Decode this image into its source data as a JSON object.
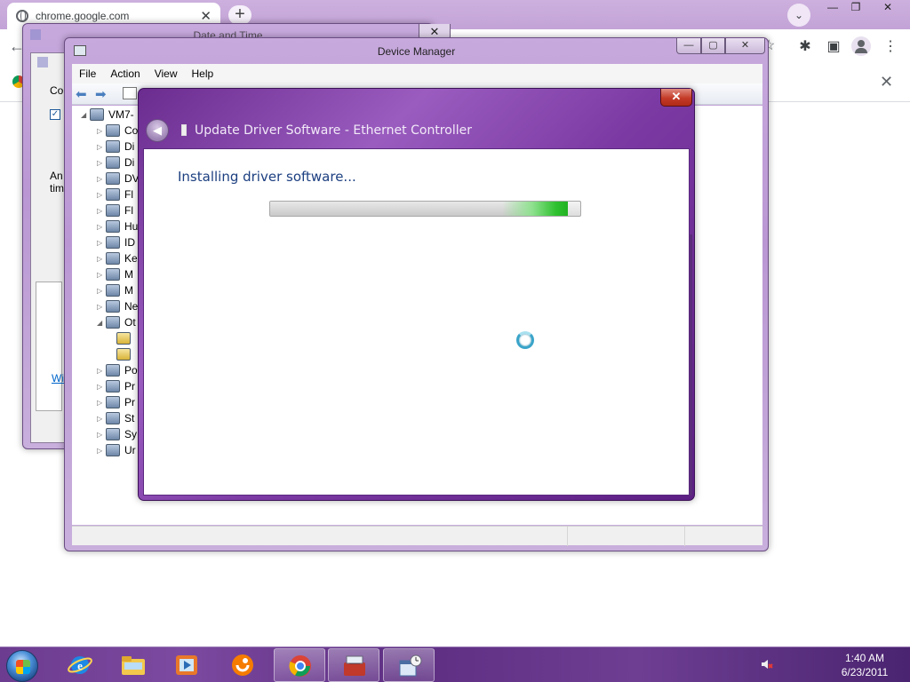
{
  "browser": {
    "tab_title": "chrome.google.com",
    "tab_close": "✕",
    "new_tab": "+",
    "tab_search": "⌄",
    "window_minimize": "—",
    "window_restore": "❐",
    "window_close": "✕",
    "back": "←",
    "star": "☆",
    "infobar_close": "✕"
  },
  "date_time": {
    "title": "Date and Time",
    "close": "✕",
    "label_co": "Co",
    "label_an": "An",
    "label_tim": "tim",
    "link_wi": "Wi",
    "check": "✓"
  },
  "device_manager": {
    "title": "Device Manager",
    "min": "—",
    "max": "▢",
    "close": "✕",
    "menu": [
      "File",
      "Action",
      "View",
      "Help"
    ],
    "tree_root": "VM7-",
    "tree_items": [
      "Co",
      "Di",
      "Di",
      "DV",
      "Fl",
      "Fl",
      "Hu",
      "ID",
      "Ke",
      "M",
      "M",
      "Ne",
      "Ot",
      "",
      "",
      "Po",
      "Pr",
      "Pr",
      "St",
      "Sy",
      "Ur"
    ]
  },
  "update_driver": {
    "title": "Update Driver Software - Ethernet Controller",
    "close": "✕",
    "back": "◀",
    "heading": "Installing driver software...",
    "progress_fraction": 0.96
  },
  "taskbar": {
    "time": "1:40 AM",
    "date": "6/23/2011",
    "apps": [
      "internet-explorer-icon",
      "explorer-icon",
      "media-player-icon",
      "uc-browser-icon",
      "chrome-icon",
      "toolbox-icon",
      "date-time-icon"
    ]
  }
}
